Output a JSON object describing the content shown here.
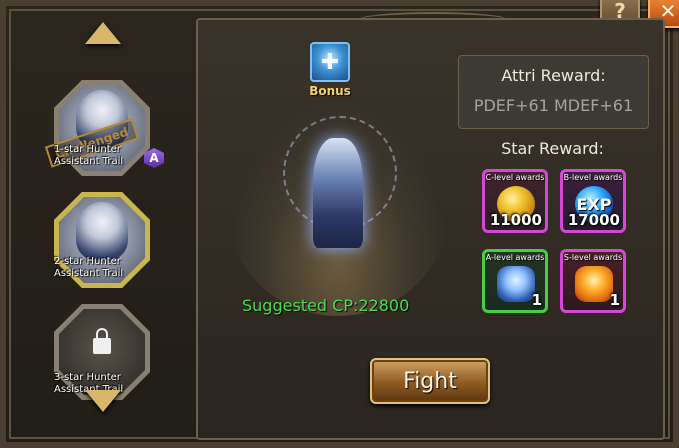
{
  "top_buttons": {
    "help_icon": "?",
    "close_icon": "✕"
  },
  "sidebar": {
    "stages": [
      {
        "label_line1": "1-star Hunter",
        "label_line2": "Assistant Trail",
        "stamp": "Challenged",
        "rank_badge": "A"
      },
      {
        "label_line1": "2-star Hunter",
        "label_line2": "Assistant Trail"
      },
      {
        "label_line1": "3-star Hunter",
        "label_line2": "Assistant Trail"
      }
    ]
  },
  "main": {
    "bonus": {
      "label": "Bonus"
    },
    "suggested_cp": "Suggested CP:22800",
    "attri_reward": {
      "title": "Attri Reward:",
      "value": "PDEF+61 MDEF+61"
    },
    "star_reward": {
      "title": "Star Reward:",
      "awards": [
        {
          "tag": "C-level awards",
          "amount": "11000"
        },
        {
          "tag": "B-level awards",
          "amount": "17000",
          "icon_text": "EXP"
        },
        {
          "tag": "A-level awards",
          "amount": "1"
        },
        {
          "tag": "S-level awards",
          "amount": "1"
        }
      ]
    },
    "fight_button": {
      "label": "Fight"
    }
  },
  "colors": {
    "accent_gold": "#d8b66b",
    "suggested_cp_green": "#42e04a",
    "award_border_purple": "#d548d6",
    "award_border_green": "#43d043"
  }
}
